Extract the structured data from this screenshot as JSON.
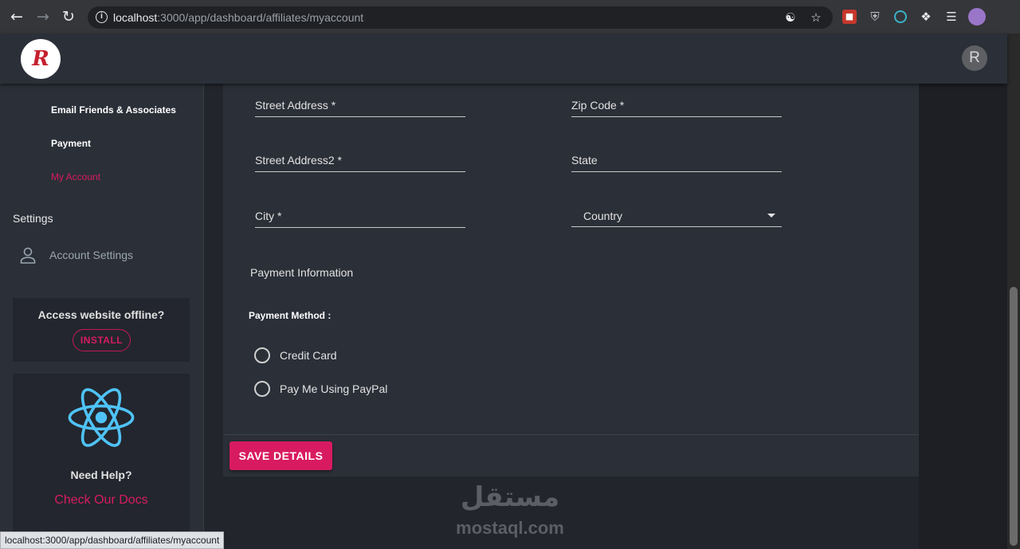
{
  "browser": {
    "url_host": "localhost",
    "url_path": ":3000/app/dashboard/affiliates/myaccount",
    "status_url": "localhost:3000/app/dashboard/affiliates/myaccount"
  },
  "header": {
    "logo_letter": "R",
    "avatar_letter": "R"
  },
  "sidebar": {
    "links": [
      {
        "label": "Email Friends & Associates",
        "active": false
      },
      {
        "label": "Payment",
        "active": false
      },
      {
        "label": "My Account",
        "active": true
      }
    ],
    "settings_heading": "Settings",
    "account_settings_label": "Account Settings",
    "offline_card": {
      "text": "Access website offline?",
      "install_label": "INSTALL"
    },
    "help_card": {
      "title": "Need Help?",
      "link_label": "Check Our Docs"
    }
  },
  "form": {
    "fields": {
      "street_address": "Street Address *",
      "zip_code": "Zip Code *",
      "street_address2": "Street Address2 *",
      "state": "State",
      "city": "City *",
      "country": "Country"
    },
    "payment_section_title": "Payment Information",
    "payment_method_label": "Payment Method :",
    "payment_options": [
      "Credit Card",
      "Pay Me Using PayPal"
    ],
    "save_label": "SAVE DETAILS"
  },
  "watermark": {
    "arabic": "مستقل",
    "latin": "mostaql.com"
  },
  "colors": {
    "accent": "#d81b60",
    "background": "#22252c",
    "panel": "#2b2f38"
  }
}
